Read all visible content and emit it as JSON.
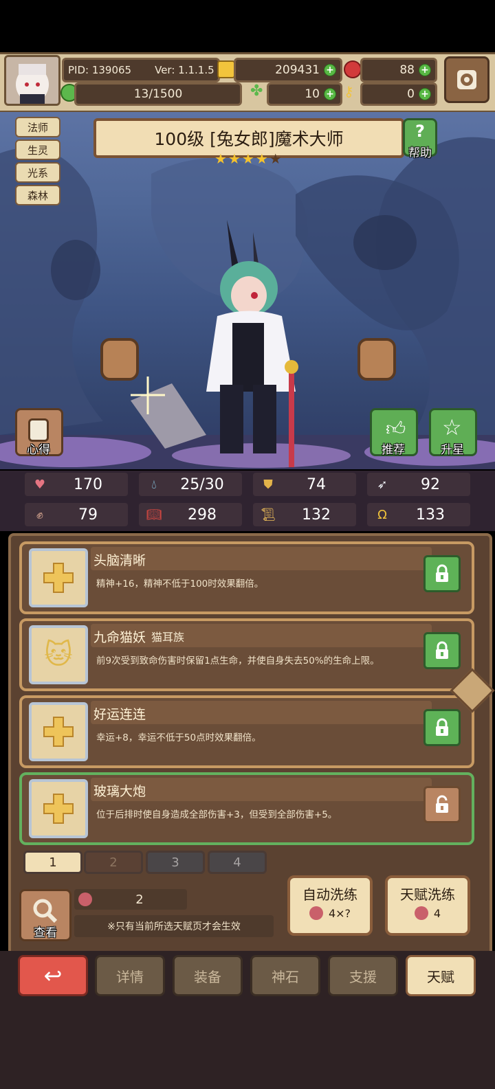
{
  "top": {
    "pid": "PID: 139065",
    "version": "Ver: 1.1.1.5",
    "gold": "209431",
    "gems": "88",
    "stamina": "13/1500",
    "clover": "10",
    "keys": "0"
  },
  "hero": {
    "tags": [
      "法师",
      "生灵",
      "光系",
      "森林"
    ],
    "title": "100级 [兔女郎]魔术大师",
    "stars": 4,
    "stars_max": 5,
    "help_label": "帮助",
    "xinde_label": "心得",
    "recommend_label": "推荐",
    "upstar_label": "升星"
  },
  "stats": [
    {
      "icon": "heart-icon",
      "value": "170"
    },
    {
      "icon": "drop-icon",
      "value": "25/30"
    },
    {
      "icon": "shield-icon",
      "value": "74"
    },
    {
      "icon": "wing-icon",
      "value": "92"
    },
    {
      "icon": "fist-icon",
      "value": "79"
    },
    {
      "icon": "book-icon",
      "value": "298"
    },
    {
      "icon": "scroll-icon",
      "value": "132"
    },
    {
      "icon": "horseshoe-icon",
      "value": "133"
    }
  ],
  "talents": [
    {
      "name": "头脑清晰",
      "sub": "",
      "desc": "精神+16，精神不低于100时效果翻倍。",
      "locked": true
    },
    {
      "name": "九命猫妖",
      "sub": "猫耳族",
      "desc": "前9次受到致命伤害时保留1点生命，并使自身失去50%的生命上限。",
      "locked": true
    },
    {
      "name": "好运连连",
      "sub": "",
      "desc": "幸运+8，幸运不低于50点时效果翻倍。",
      "locked": true
    },
    {
      "name": "玻璃大炮",
      "sub": "",
      "desc": "位于后排时使自身造成全部伤害+3，但受到全部伤害+5。",
      "locked": false
    }
  ],
  "pages": [
    "1",
    "2",
    "3",
    "4"
  ],
  "bottom": {
    "view_label": "查看",
    "potion_count": "2",
    "note": "※只有当前所选天赋页才会生效",
    "auto_label": "自动洗练",
    "auto_cost": "4×?",
    "talent_label": "天赋洗练",
    "talent_cost": "4"
  },
  "nav": [
    "详情",
    "装备",
    "神石",
    "支援",
    "天赋"
  ],
  "colors": {
    "accent_green": "#5fae55",
    "back_red": "#e2574c",
    "active_tab": "#f1dfb6"
  }
}
